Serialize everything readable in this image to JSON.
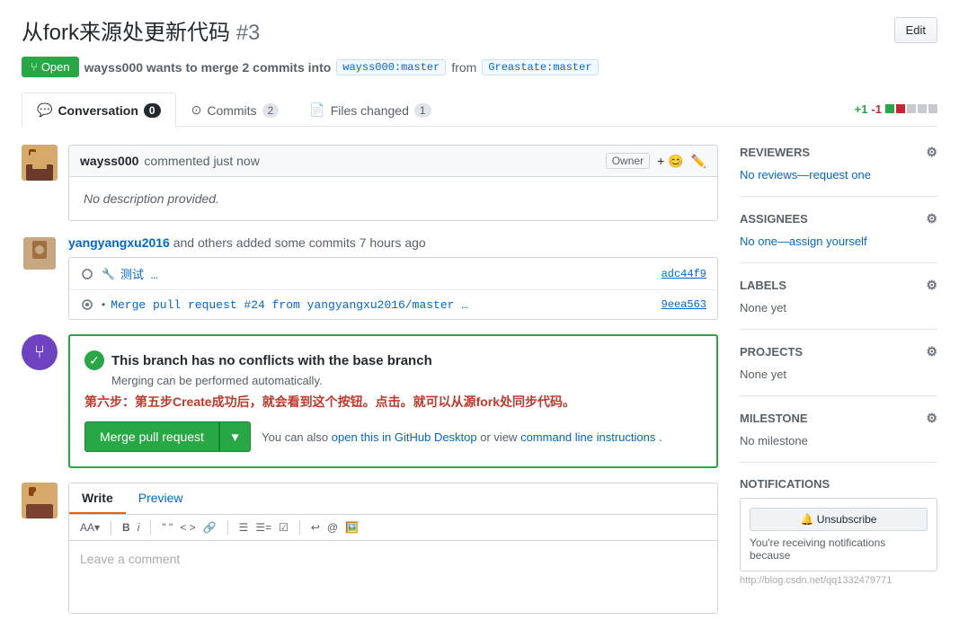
{
  "page": {
    "title": "从fork来源处更新代码",
    "pr_number": "#3",
    "edit_button": "Edit"
  },
  "status": {
    "badge": "Open",
    "badge_icon": "git-pull-request",
    "description": "wayss000 wants to merge 2 commits into",
    "target_branch": "wayss000:master",
    "from_word": "from",
    "source_branch": "Greastate:master"
  },
  "tabs": [
    {
      "id": "conversation",
      "icon": "💬",
      "label": "Conversation",
      "count": "0",
      "active": true
    },
    {
      "id": "commits",
      "icon": "○",
      "label": "Commits",
      "count": "2",
      "active": false
    },
    {
      "id": "files_changed",
      "icon": "📄",
      "label": "Files changed",
      "count": "1",
      "active": false
    }
  ],
  "diff_stats": {
    "additions": "+1",
    "deletions": "-1"
  },
  "comment": {
    "author": "wayss000",
    "time": "commented just now",
    "owner_label": "Owner",
    "content": "No description provided.",
    "emoji_btn": "😊"
  },
  "activity": {
    "author": "yangyangxu2016",
    "description": "and others added some commits 7 hours ago"
  },
  "commits": [
    {
      "icon": "○",
      "message": "测试 …",
      "sha": "adc44f9"
    },
    {
      "icon": "•",
      "message": "Merge pull request #24 from yangyangxu2016/master …",
      "sha": "9eea563"
    }
  ],
  "merge": {
    "title": "This branch has no conflicts with the base branch",
    "subtitle": "Merging can be performed automatically.",
    "annotation": "第六步：第五步Create成功后，就会看到这个按钮。点击。就可以从源fork处同步代码。",
    "merge_btn": "Merge pull request",
    "merge_note_prefix": "You can also",
    "merge_link1": "open this in GitHub Desktop",
    "merge_note_mid": "or view",
    "merge_link2": "command line instructions",
    "merge_note_suffix": "."
  },
  "write_section": {
    "write_tab": "Write",
    "preview_tab": "Preview",
    "placeholder": "Leave a comment",
    "toolbar": [
      "AA▾",
      "B",
      "i",
      "❝❝",
      "< >",
      "🔗",
      "|",
      "☰",
      "☰☰",
      "☰🔢",
      "|",
      "↩ @ 🖼️"
    ]
  },
  "sidebar": {
    "reviewers": {
      "title": "Reviewers",
      "value": "No reviews—request one"
    },
    "assignees": {
      "title": "Assignees",
      "value": "No one—assign yourself"
    },
    "labels": {
      "title": "Labels",
      "value": "None yet"
    },
    "projects": {
      "title": "Projects",
      "value": "None yet"
    },
    "milestone": {
      "title": "Milestone",
      "value": "No milestone"
    },
    "notifications": {
      "title": "Notifications",
      "unsubscribe": "🔔 Unsubscribe",
      "description": "You're receiving notifications because"
    }
  },
  "watermark": "http://blog.csdn.net/qq1332479771"
}
